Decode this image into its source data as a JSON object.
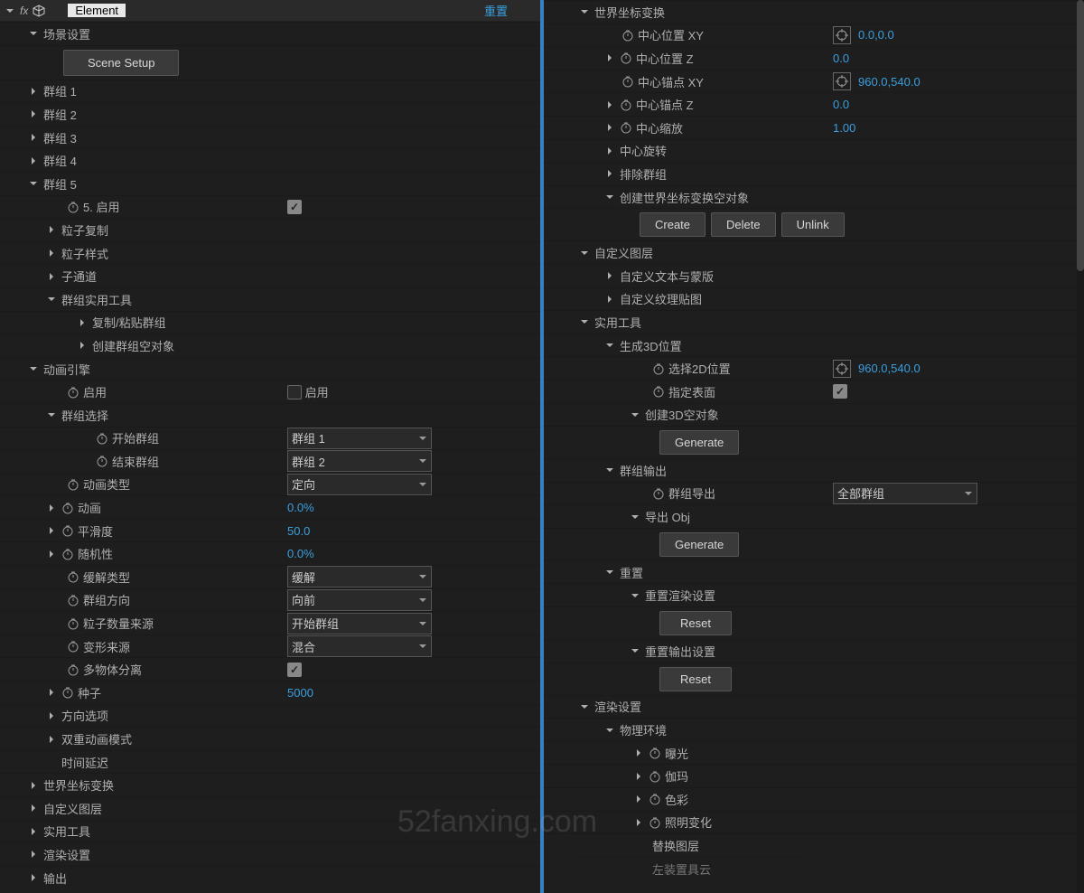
{
  "header": {
    "fx_icon": "fx",
    "effect_name": "Element",
    "reset": "重置"
  },
  "left": {
    "scene_settings": "场景设置",
    "scene_setup_btn": "Scene Setup",
    "group1": "群组 1",
    "group2": "群组 2",
    "group3": "群组 3",
    "group4": "群组 4",
    "group5": "群组 5",
    "g5_enable_label": "5. 启用",
    "particle_copy": "粒子复制",
    "particle_style": "粒子样式",
    "sub_channel": "子通道",
    "group_utils": "群组实用工具",
    "copy_paste_group": "复制/粘贴群组",
    "create_group_null": "创建群组空对象",
    "anim_engine": "动画引擎",
    "enable": "启用",
    "enable_cb": "启用",
    "group_select": "群组选择",
    "start_group": "开始群组",
    "start_group_val": "群组 1",
    "end_group": "结束群组",
    "end_group_val": "群组 2",
    "anim_type": "动画类型",
    "anim_type_val": "定向",
    "animation": "动画",
    "animation_val": "0.0%",
    "smoothness": "平滑度",
    "smoothness_val": "50.0",
    "randomness": "随机性",
    "randomness_val": "0.0%",
    "ease_type": "缓解类型",
    "ease_type_val": "缓解",
    "group_dir": "群组方向",
    "group_dir_val": "向前",
    "particle_count_src": "粒子数量来源",
    "particle_count_src_val": "开始群组",
    "morph_src": "变形来源",
    "morph_src_val": "混合",
    "multi_obj_sep": "多物体分离",
    "seed": "种子",
    "seed_val": "5000",
    "orient_options": "方向选项",
    "double_anim": "双重动画模式",
    "time_delay": "时间延迟",
    "world_xform": "世界坐标变换",
    "custom_layers": "自定义图层",
    "utility": "实用工具",
    "render_settings": "渲染设置",
    "output": "输出"
  },
  "right": {
    "world_xform": "世界坐标变换",
    "center_pos_xy": "中心位置 XY",
    "center_pos_xy_val": "0.0,0.0",
    "center_pos_z": "中心位置 Z",
    "center_pos_z_val": "0.0",
    "center_anchor_xy": "中心锚点 XY",
    "center_anchor_xy_val": "960.0,540.0",
    "center_anchor_z": "中心锚点 Z",
    "center_anchor_z_val": "0.0",
    "center_scale": "中心缩放",
    "center_scale_val": "1.00",
    "center_rotation": "中心旋转",
    "exclude_groups": "排除群组",
    "create_world_null": "创建世界坐标变换空对象",
    "create_btn": "Create",
    "delete_btn": "Delete",
    "unlink_btn": "Unlink",
    "custom_layers": "自定义图层",
    "custom_text_mask": "自定义文本与蒙版",
    "custom_tex_map": "自定义纹理贴图",
    "utility": "实用工具",
    "gen_3d_pos": "生成3D位置",
    "select_2d_pos": "选择2D位置",
    "select_2d_pos_val": "960.0,540.0",
    "specify_surface": "指定表面",
    "create_3d_null": "创建3D空对象",
    "generate_btn": "Generate",
    "group_output": "群组输出",
    "group_export": "群组导出",
    "group_export_val": "全部群组",
    "export_obj": "导出 Obj",
    "reset": "重置",
    "reset_render": "重置渲染设置",
    "reset_output": "重置输出设置",
    "reset_btn": "Reset",
    "render_settings": "渲染设置",
    "phys_env": "物理环境",
    "exposure": "曝光",
    "gamma": "伽玛",
    "color": "色彩",
    "illum_change": "照明变化",
    "swap_layer": "替换图层",
    "load_null": "左装置具云"
  },
  "watermark": "52fanxing.com"
}
